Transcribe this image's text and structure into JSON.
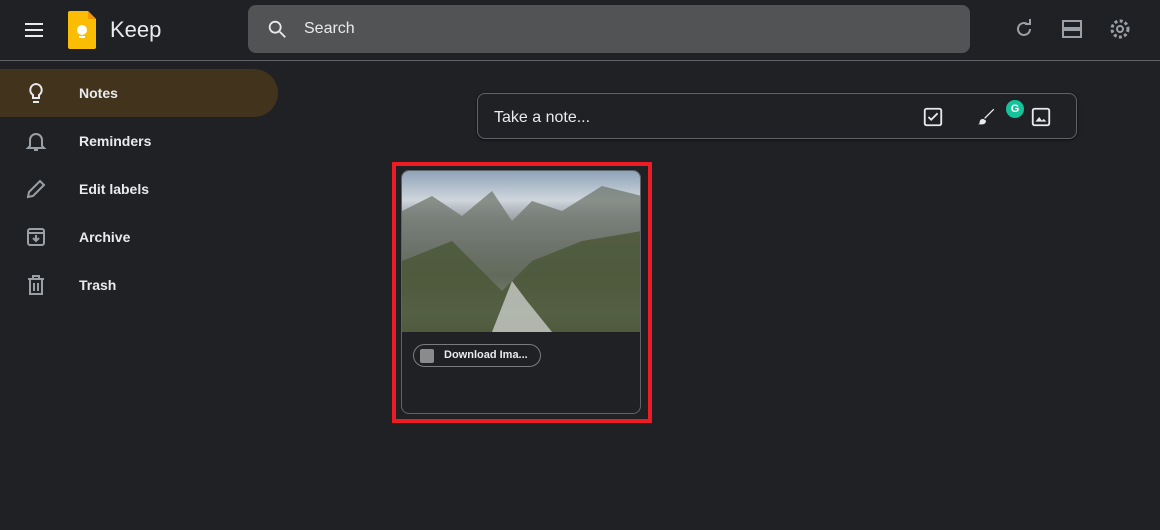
{
  "header": {
    "app_name": "Keep",
    "search_placeholder": "Search"
  },
  "sidebar": {
    "items": [
      {
        "label": "Notes",
        "icon": "lightbulb-icon",
        "active": true
      },
      {
        "label": "Reminders",
        "icon": "bell-icon"
      },
      {
        "label": "Edit labels",
        "icon": "pencil-icon"
      },
      {
        "label": "Archive",
        "icon": "archive-icon"
      },
      {
        "label": "Trash",
        "icon": "trash-icon"
      }
    ]
  },
  "take_note": {
    "placeholder": "Take a note...",
    "badge": "G"
  },
  "note": {
    "chip_label": "Download Ima..."
  },
  "colors": {
    "background": "#202124",
    "active_nav": "#41331c",
    "highlight": "#ed1c24",
    "logo": "#fbbc04"
  }
}
